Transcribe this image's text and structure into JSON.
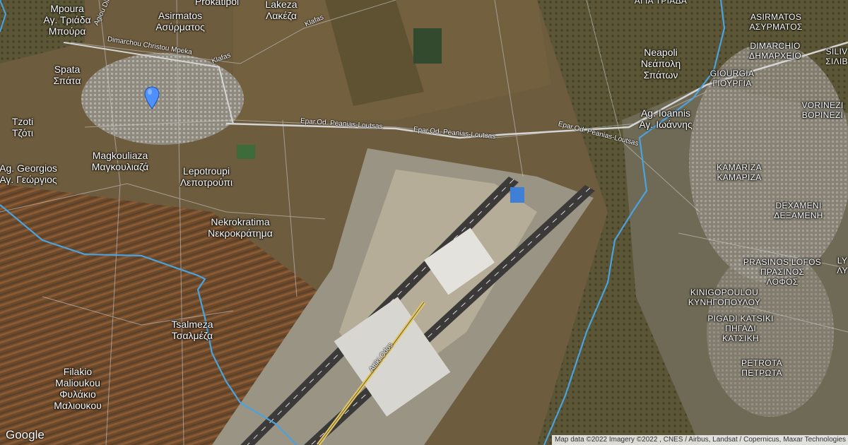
{
  "map": {
    "places": [
      {
        "id": "mpoura",
        "latin": "Mpoura",
        "greek": "Αγ. Τριάδα Μπούρα",
        "line1": "Mpoura",
        "line2": "Αγ. Τριάδα",
        "line3": "Μπούρα"
      },
      {
        "id": "asirmatos-west",
        "line1": "Asirmatos",
        "line2": "Ασύρματος"
      },
      {
        "id": "prokatipoi",
        "line1": "Prokatipoi"
      },
      {
        "id": "lakeza",
        "line1": "Lakeza",
        "line2": "Λακέζα"
      },
      {
        "id": "spata",
        "line1": "Spata",
        "line2": "Σπάτα"
      },
      {
        "id": "tzoti",
        "line1": "Tzoti",
        "line2": "Τζότι"
      },
      {
        "id": "magkouliaza",
        "line1": "Magkouliaza",
        "line2": "Μαγκουλιαζά"
      },
      {
        "id": "ag-georgios",
        "line1": "Ag. Georgios",
        "line2": "Αγ. Γεώργιος"
      },
      {
        "id": "lepotroupi",
        "line1": "Lepotroupi",
        "line2": "Λεποτρούπι"
      },
      {
        "id": "nekrokratima",
        "line1": "Nekrokratima",
        "line2": "Νεκροκράτημα"
      },
      {
        "id": "tsalmeza",
        "line1": "Tsalmeza",
        "line2": "Τσαλμέζα"
      },
      {
        "id": "filakio",
        "line1": "Filakio",
        "line2": "Malioukou",
        "line3": "Φυλάκιο",
        "line4": "Μαλιουκου"
      },
      {
        "id": "agia-triada",
        "line1": "ΑΓΙΑ ΤΡΙΑΔΑ"
      },
      {
        "id": "neapoli",
        "line1": "Neapoli",
        "line2": "Νεάπολη",
        "line3": "Σπάτων"
      },
      {
        "id": "ag-ioannis",
        "line1": "Ag. Ioannis",
        "line2": "Αγ. Ιωάννης"
      },
      {
        "id": "asirmatos-east",
        "line1": "ASIRMATOS",
        "line2": "ΑΣΥΡΜΑΤΟΣ"
      },
      {
        "id": "dimarchio",
        "line1": "DIMARCHIO",
        "line2": "ΔΗΜΑΡΧΕΙΟ"
      },
      {
        "id": "silivr",
        "line1": "SILIV",
        "line2": "ΣΙΛΙΒ"
      },
      {
        "id": "giourgia",
        "line1": "GIOURGIA",
        "line2": "ΓΙΟΥΡΓΙΑ"
      },
      {
        "id": "vorinezi",
        "line1": "VORINEZI",
        "line2": "ΒΟΡΙΝΕΖΙ"
      },
      {
        "id": "kamariza",
        "line1": "KAMARIZA",
        "line2": "ΚΑΜΑΡΙΖΑ"
      },
      {
        "id": "dexameni",
        "line1": "DEXAMENI",
        "line2": "ΔΕΞΑΜΕΝΗ"
      },
      {
        "id": "prasinos-lofos",
        "line1": "PRASINOS LOFOS",
        "line2": "ΠΡΑΣΙΝΟΣ",
        "line3": "ΛΟΦΟΣ"
      },
      {
        "id": "ly",
        "line1": "LY",
        "line2": "ΛΥ"
      },
      {
        "id": "kinigopoulou",
        "line1": "KINIGOPOULOU",
        "line2": "ΚΥΝΗΓΟΠΟΥΛΟΥ"
      },
      {
        "id": "pigadi-katsiki",
        "line1": "PIGADI KATSIKI",
        "line2": "ΠΗΓΑΔΙ",
        "line3": "ΚΑΤΣΙΚΗ"
      },
      {
        "id": "petrota",
        "line1": "PETROTA",
        "line2": "ΠΕΤΡΩΤΑ"
      }
    ],
    "roads": {
      "dimarchou": "Dimarchou Christou Mpeka",
      "klafas1": "Klafas",
      "klafas2": "Klafas",
      "epar1": "Epar.Od. Peanias-Loutsas",
      "epar2": "Epar.Od. Peanias-Loutsas",
      "epar3": "Epar.Od. Peanias-Loutsas",
      "agiou": "Agiou Dim",
      "attiki": "Attiki Odos"
    },
    "pin": {
      "label": "location-marker",
      "color": "#4d90fe"
    },
    "colors": {
      "river": "#4aa3df",
      "road": "#c8c8c8",
      "highway": "#e2c86a"
    }
  },
  "footer": {
    "logo": "Google",
    "attribution": "Map data ©2022 Imagery ©2022 , CNES / Airbus, Landsat / Copernicus, Maxar Technologies"
  }
}
